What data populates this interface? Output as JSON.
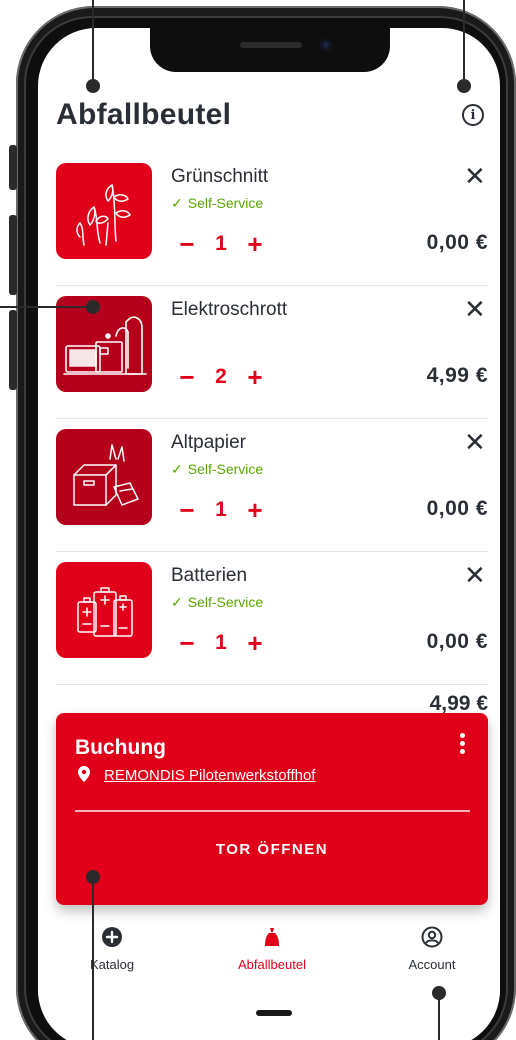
{
  "header": {
    "title": "Abfallbeutel",
    "info_icon": "info-icon"
  },
  "items": [
    {
      "name": "Grünschnitt",
      "self_service": true,
      "self_service_label": "Self-Service",
      "qty": "1",
      "price": "0,00 €",
      "remove_icon": "close-icon",
      "minus": "−",
      "plus": "+",
      "icon": "green-waste-icon"
    },
    {
      "name": "Elektroschrott",
      "self_service": false,
      "qty": "2",
      "price": "4,99 €",
      "remove_icon": "close-icon",
      "minus": "−",
      "plus": "+",
      "icon": "electronics-icon"
    },
    {
      "name": "Altpapier",
      "self_service": true,
      "self_service_label": "Self-Service",
      "qty": "1",
      "price": "0,00 €",
      "remove_icon": "close-icon",
      "minus": "−",
      "plus": "+",
      "icon": "paper-icon"
    },
    {
      "name": "Batterien",
      "self_service": true,
      "self_service_label": "Self-Service",
      "qty": "1",
      "price": "0,00 €",
      "remove_icon": "close-icon",
      "minus": "−",
      "plus": "+",
      "icon": "battery-icon"
    }
  ],
  "total_peek": "4,99 €",
  "booking": {
    "title": "Buchung",
    "location": "REMONDIS Pilotenwerkstoffhof",
    "action": "TOR ÖFFNEN"
  },
  "nav": [
    {
      "label": "Katalog",
      "icon": "add-circle-icon",
      "active": false
    },
    {
      "label": "Abfallbeutel",
      "icon": "bag-icon",
      "active": true
    },
    {
      "label": "Account",
      "icon": "account-icon",
      "active": false
    }
  ],
  "colors": {
    "brand": "#e1001a",
    "brand_dark": "#b5001c",
    "success": "#58a600",
    "text": "#2a2f36"
  }
}
